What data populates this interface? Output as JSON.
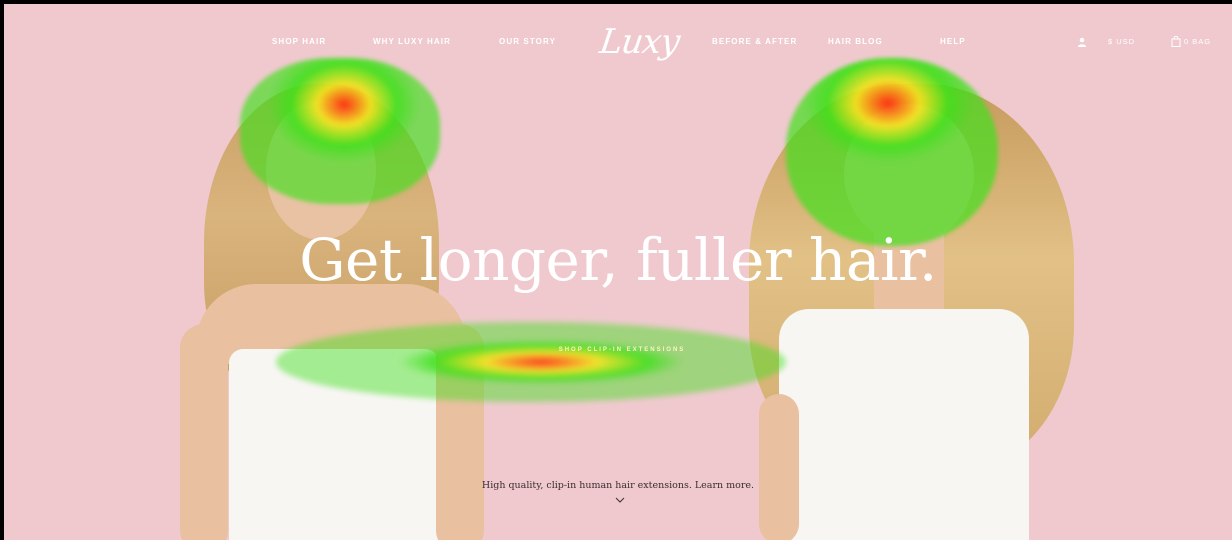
{
  "nav": {
    "left_links": [
      "SHOP HAIR",
      "WHY LUXY HAIR",
      "OUR STORY"
    ],
    "logo": "Luxy",
    "right_links": [
      "BEFORE & AFTER",
      "HAIR BLOG",
      "HELP"
    ],
    "currency": "$ USD",
    "bag": "0 BAG"
  },
  "hero": {
    "headline": "Get longer, fuller hair.",
    "cta_label": "SHOP CLIP-IN EXTENSIONS",
    "subtext": "High quality, clip-in human hair extensions. Learn more.",
    "scroll_icon": "chevron-down-icon"
  },
  "colors": {
    "background": "#efc9ce",
    "heat_low": "#3ee01a",
    "heat_mid": "#f2e51c",
    "heat_high": "#ff2a10"
  }
}
